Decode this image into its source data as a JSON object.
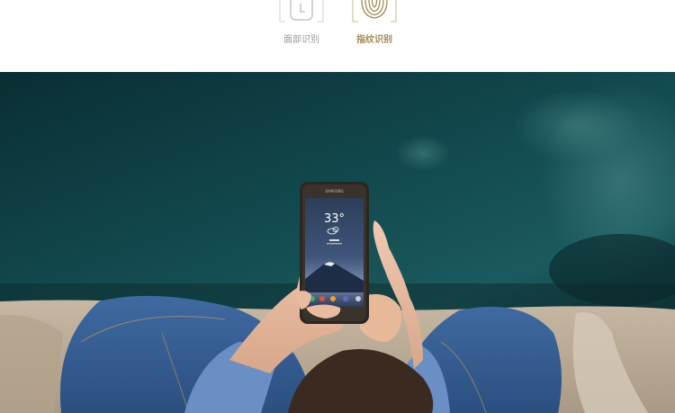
{
  "features": [
    {
      "label": "面部识别",
      "icon": "face-recognition-icon",
      "color": "#9a9a9a"
    },
    {
      "label": "指纹识别",
      "icon": "fingerprint-icon",
      "color": "#a18a55",
      "selected": true
    }
  ],
  "phone": {
    "brand": "SAMSUNG",
    "temperature": "33°",
    "weather_icon": "cloud-icon"
  },
  "colors": {
    "water": "#0f3e43",
    "rock": "#b8aa98",
    "jeans": "#345a8c",
    "gold_accent": "#a18a55"
  }
}
